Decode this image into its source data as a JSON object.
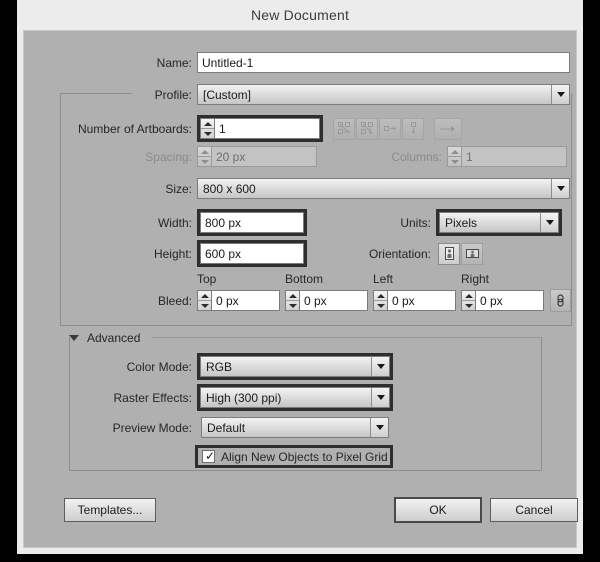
{
  "window": {
    "title": "New Document"
  },
  "fields": {
    "name": {
      "label": "Name:",
      "value": "Untitled-1"
    },
    "profile": {
      "label": "Profile:",
      "value": "[Custom]"
    },
    "artboards": {
      "label": "Number of Artboards:",
      "value": "1"
    },
    "spacing": {
      "label": "Spacing:",
      "value": "20 px"
    },
    "columns": {
      "label": "Columns:",
      "value": "1"
    },
    "size": {
      "label": "Size:",
      "value": "800 x 600"
    },
    "width": {
      "label": "Width:",
      "value": "800 px"
    },
    "height": {
      "label": "Height:",
      "value": "600 px"
    },
    "units": {
      "label": "Units:",
      "value": "Pixels"
    },
    "orientation": {
      "label": "Orientation:"
    }
  },
  "artboard_layout_buttons": [
    {
      "name": "grid-by-row-icon",
      "tooltip": "Grid by Row"
    },
    {
      "name": "grid-by-column-icon",
      "tooltip": "Grid by Column"
    },
    {
      "name": "arrange-by-row-icon",
      "tooltip": "Arrange by Row"
    },
    {
      "name": "arrange-by-column-icon",
      "tooltip": "Arrange by Column"
    }
  ],
  "artboard_direction_button": {
    "name": "change-to-right-to-left-layout-icon"
  },
  "bleed": {
    "label": "Bleed:",
    "columns": [
      "Top",
      "Bottom",
      "Left",
      "Right"
    ],
    "values": [
      "0 px",
      "0 px",
      "0 px",
      "0 px"
    ],
    "link_icon": "link-bleed-values-icon"
  },
  "advanced": {
    "label": "Advanced",
    "color_mode": {
      "label": "Color Mode:",
      "value": "RGB"
    },
    "raster_effects": {
      "label": "Raster Effects:",
      "value": "High (300 ppi)"
    },
    "preview_mode": {
      "label": "Preview Mode:",
      "value": "Default"
    },
    "align_pixel_grid": {
      "label": "Align New Objects to Pixel Grid",
      "checked": "✓"
    }
  },
  "buttons": {
    "templates": "Templates...",
    "ok": "OK",
    "cancel": "Cancel"
  },
  "colors": {
    "dialog_bg": "#b0b0b0",
    "titlebar_bg": "#ececec",
    "focus_ring": "#2e2e2e",
    "field_bg": "#ffffff"
  }
}
